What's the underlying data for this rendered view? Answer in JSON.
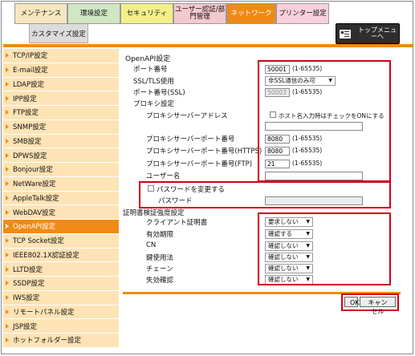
{
  "tabs": [
    {
      "label": "メンテナンス",
      "color": "#f7e6bf",
      "active": false
    },
    {
      "label": "環境設定",
      "color": "#d0e7c4",
      "active": false
    },
    {
      "label": "セキュリティ",
      "color": "#f3f08a",
      "active": false
    },
    {
      "label": "ユーザー認証/部門管理",
      "color": "#f3c9d0",
      "active": false
    },
    {
      "label": "ネットワーク",
      "color": "#f08a16",
      "active": true
    },
    {
      "label": "プリンター設定",
      "color": "#f7d0dc",
      "active": false
    }
  ],
  "subtab": {
    "label": "カスタマイズ設定"
  },
  "top_menu": {
    "label": "トップメニューへ"
  },
  "sidebar": {
    "items": [
      {
        "label": "TCP/IP設定",
        "active": false
      },
      {
        "label": "E-mail設定",
        "active": false
      },
      {
        "label": "LDAP設定",
        "active": false
      },
      {
        "label": "IPP設定",
        "active": false
      },
      {
        "label": "FTP設定",
        "active": false
      },
      {
        "label": "SNMP設定",
        "active": false
      },
      {
        "label": "SMB設定",
        "active": false
      },
      {
        "label": "DPWS設定",
        "active": false
      },
      {
        "label": "Bonjour設定",
        "active": false
      },
      {
        "label": "NetWare設定",
        "active": false
      },
      {
        "label": "AppleTalk設定",
        "active": false
      },
      {
        "label": "WebDAV設定",
        "active": false
      },
      {
        "label": "OpenAPI設定",
        "active": true
      },
      {
        "label": "TCP Socket設定",
        "active": false
      },
      {
        "label": "IEEE802.1X認証設定",
        "active": false
      },
      {
        "label": "LLTD設定",
        "active": false
      },
      {
        "label": "SSDP設定",
        "active": false
      },
      {
        "label": "IWS設定",
        "active": false
      },
      {
        "label": "リモートパネル設定",
        "active": false
      },
      {
        "label": "JSP設定",
        "active": false
      },
      {
        "label": "ホットフォルダー設定",
        "active": false
      }
    ]
  },
  "form": {
    "title": "OpenAPI設定",
    "port_label": "ポート番号",
    "port_value": "50001",
    "port_range": "(1-65535)",
    "ssl_label": "SSL/TLS使用",
    "ssl_value": "非SSL通信のみ可",
    "port_ssl_label": "ポート番号(SSL)",
    "port_ssl_value": "50003",
    "port_ssl_range": "(1-65535)",
    "proxy_label": "プロキシ設定",
    "proxy_address_label": "プロキシサーバーアドレス",
    "hostname_check_label": "ホスト名入力時はチェックをONにする",
    "proxy_address_value": "",
    "proxy_port_label": "プロキシサーバーポート番号",
    "proxy_port_value": "8080",
    "proxy_port_range": "(1-65535)",
    "proxy_port_https_label": "プロキシサーバーポート番号(HTTPS)",
    "proxy_port_https_value": "8080",
    "proxy_port_https_range": "(1-65535)",
    "proxy_port_ftp_label": "プロキシサーバーポート番号(FTP)",
    "proxy_port_ftp_value": "21",
    "proxy_port_ftp_range": "(1-65535)",
    "username_label": "ユーザー名",
    "username_value": "",
    "change_password_label": "パスワードを変更する",
    "password_label": "パスワード",
    "password_value": "",
    "cert_label": "証明書検証強度設定",
    "client_cert_label": "クライアント証明書",
    "client_cert_value": "要求しない",
    "validity_label": "有効期限",
    "validity_value": "確認する",
    "cn_label": "CN",
    "cn_value": "確認しない",
    "key_usage_label": "鍵使用法",
    "key_usage_value": "確認しない",
    "chain_label": "チェーン",
    "chain_value": "確認しない",
    "revocation_label": "失効確認",
    "revocation_value": "確認しない"
  },
  "buttons": {
    "ok": "OK",
    "cancel": "キャンセル"
  },
  "colors": {
    "accent": "#f08a16",
    "highlight_box": "#d0001a",
    "sidebar_bg": "#fde3b5"
  }
}
